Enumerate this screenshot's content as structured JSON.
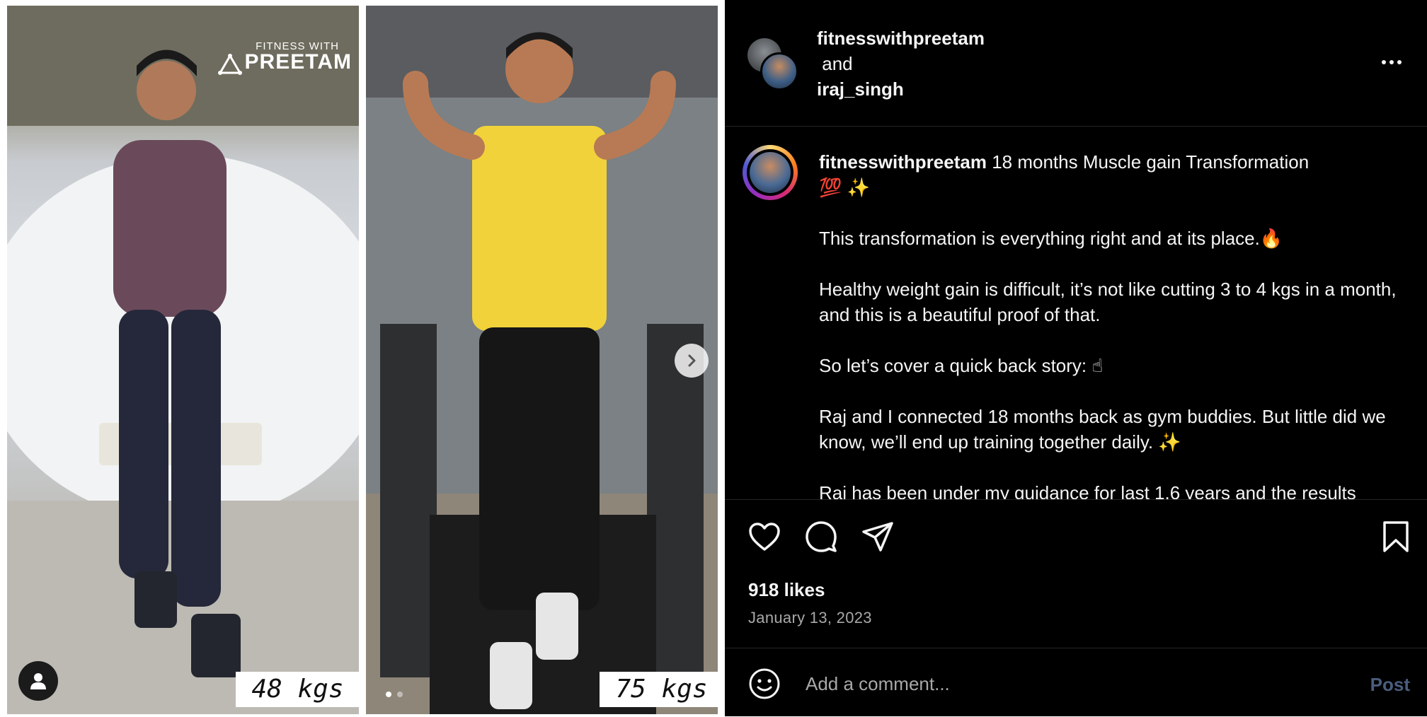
{
  "media": {
    "watermark": {
      "small": "FITNESS WITH",
      "big": "PREETAM"
    },
    "left_photo": {
      "weight_label": "48 kgs"
    },
    "right_photo": {
      "weight_label": "75 kgs"
    },
    "carousel": {
      "total": 2,
      "current": 1
    }
  },
  "header": {
    "user1": "fitnesswithpreetam",
    "joiner": "and",
    "user2": "iraj_singh",
    "icons": {
      "more": "more-horizontal-icon"
    }
  },
  "caption": {
    "username": "fitnesswithpreetam",
    "title": "18 months Muscle gain Transformation",
    "title_emoji": "💯 ✨",
    "paragraphs": [
      "This transformation is everything right and at its place.🔥",
      "Healthy weight gain is difficult, it’s not like cutting 3 to 4 kgs in a month, and this is a beautiful proof of that.",
      "So let’s cover a quick back story: ☝",
      "Raj and I connected 18 months back as gym buddies. But little did we know, we’ll end up training together daily. ✨",
      "Raj has been under my guidance for last 1.6 years and the results"
    ]
  },
  "actions": {
    "likes": "918 likes",
    "date": "January 13, 2023",
    "icons": [
      "heart-icon",
      "comment-icon",
      "share-icon",
      "bookmark-icon"
    ]
  },
  "comment": {
    "placeholder": "Add a comment...",
    "post_label": "Post"
  },
  "colors": {
    "panel_bg": "#000000",
    "text": "#f5f5f5",
    "muted": "#a8a8a8",
    "divider": "#262626",
    "post_disabled": "#4a5d7e"
  }
}
